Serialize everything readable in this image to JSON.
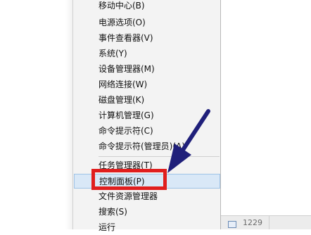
{
  "menu": {
    "items": [
      {
        "label": "移动中心(B)"
      },
      {
        "label": "电源选项(O)"
      },
      {
        "label": "事件查看器(V)"
      },
      {
        "label": "系统(Y)"
      },
      {
        "label": "设备管理器(M)"
      },
      {
        "label": "网络连接(W)"
      },
      {
        "label": "磁盘管理(K)"
      },
      {
        "label": "计算机管理(G)"
      },
      {
        "label": "命令提示符(C)"
      },
      {
        "label": "命令提示符(管理员)(A)"
      },
      {
        "label": "任务管理器(T)"
      },
      {
        "label": "控制面板(P)"
      },
      {
        "label": "文件资源管理器"
      },
      {
        "label": "搜索(S)"
      },
      {
        "label": "运行"
      }
    ],
    "highlighted_index": 11
  },
  "taskbar": {
    "partial_text": "1229"
  },
  "colors": {
    "callout_border": "#e01e1e",
    "arrow": "#1f1f7a",
    "highlight_bg": "#d9e8f7"
  }
}
